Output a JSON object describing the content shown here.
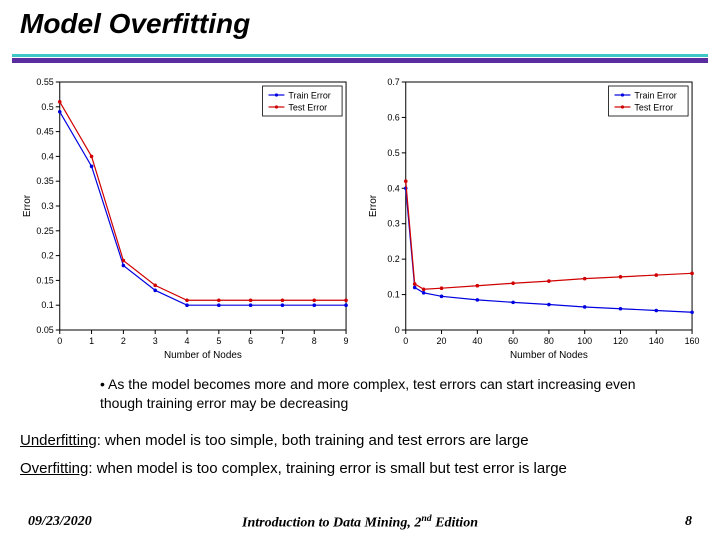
{
  "title": "Model Overfitting",
  "bullet": "• As the model becomes more and more complex, test errors can start increasing even though training error may be decreasing",
  "under_label": "Underfitting",
  "under_rest": ": when model is too simple, both training and test errors are large",
  "over_label": "Overfitting",
  "over_rest": ": when model is too complex, training error is small but test error is large",
  "footer_date": "09/23/2020",
  "footer_center_a": "Introduction to Data Mining, 2",
  "footer_center_sup": "nd",
  "footer_center_b": " Edition",
  "page_number": "8",
  "legend_train": "Train Error",
  "legend_test": "Test Error",
  "axis_x_label": "Number of Nodes",
  "axis_y_label": "Error",
  "chart_data": [
    {
      "type": "line",
      "title": "",
      "xlabel": "Number of Nodes",
      "ylabel": "Error",
      "xlim": [
        0,
        9
      ],
      "ylim": [
        0.05,
        0.55
      ],
      "x_ticks": [
        0,
        1,
        2,
        3,
        4,
        5,
        6,
        7,
        8,
        9
      ],
      "y_ticks": [
        0.05,
        0.1,
        0.15,
        0.2,
        0.25,
        0.3,
        0.35,
        0.4,
        0.45,
        0.5,
        0.55
      ],
      "series": [
        {
          "name": "Train Error",
          "color": "#0000e0",
          "x": [
            0,
            1,
            2,
            3,
            4,
            5,
            6,
            7,
            8,
            9
          ],
          "y": [
            0.49,
            0.38,
            0.18,
            0.13,
            0.1,
            0.1,
            0.1,
            0.1,
            0.1,
            0.1
          ]
        },
        {
          "name": "Test Error",
          "color": "#d00000",
          "x": [
            0,
            1,
            2,
            3,
            4,
            5,
            6,
            7,
            8,
            9
          ],
          "y": [
            0.51,
            0.4,
            0.19,
            0.14,
            0.11,
            0.11,
            0.11,
            0.11,
            0.11,
            0.11
          ]
        }
      ]
    },
    {
      "type": "line",
      "title": "",
      "xlabel": "Number of Nodes",
      "ylabel": "Error",
      "xlim": [
        0,
        160
      ],
      "ylim": [
        0,
        0.7
      ],
      "x_ticks": [
        0,
        20,
        40,
        60,
        80,
        100,
        120,
        140,
        160
      ],
      "y_ticks": [
        0,
        0.1,
        0.2,
        0.3,
        0.4,
        0.5,
        0.6,
        0.7
      ],
      "series": [
        {
          "name": "Train Error",
          "color": "#0000e0",
          "x": [
            0,
            5,
            10,
            20,
            40,
            60,
            80,
            100,
            120,
            140,
            160
          ],
          "y": [
            0.4,
            0.12,
            0.105,
            0.095,
            0.085,
            0.078,
            0.072,
            0.065,
            0.06,
            0.055,
            0.05
          ]
        },
        {
          "name": "Test Error",
          "color": "#d00000",
          "x": [
            0,
            5,
            10,
            20,
            40,
            60,
            80,
            100,
            120,
            140,
            160
          ],
          "y": [
            0.42,
            0.13,
            0.115,
            0.118,
            0.125,
            0.132,
            0.138,
            0.145,
            0.15,
            0.155,
            0.16
          ]
        }
      ]
    }
  ]
}
